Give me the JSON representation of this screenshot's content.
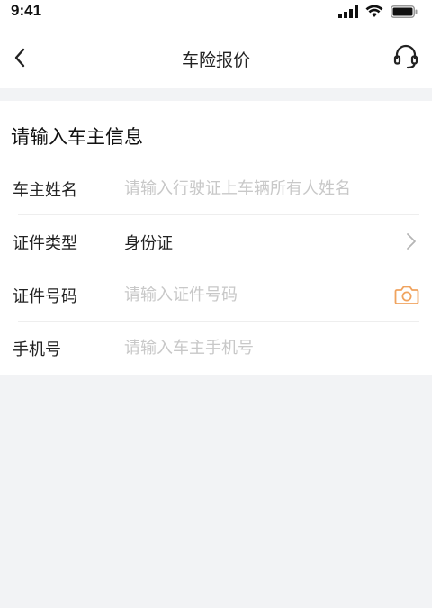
{
  "status_bar": {
    "time": "9:41"
  },
  "nav": {
    "title": "车险报价",
    "back_icon": "chevron-left-icon",
    "service_icon": "headset-icon"
  },
  "form": {
    "section_title": "请输入车主信息",
    "owner_name": {
      "label": "车主姓名",
      "placeholder": "请输入行驶证上车辆所有人姓名"
    },
    "id_type": {
      "label": "证件类型",
      "value": "身份证"
    },
    "id_number": {
      "label": "证件号码",
      "placeholder": "请输入证件号码",
      "icon": "camera-icon"
    },
    "phone": {
      "label": "手机号",
      "placeholder": "请输入车主手机号"
    }
  },
  "colors": {
    "accent": "#f0a35e",
    "page_background": "#f2f3f5",
    "placeholder": "#c8c8c8"
  }
}
